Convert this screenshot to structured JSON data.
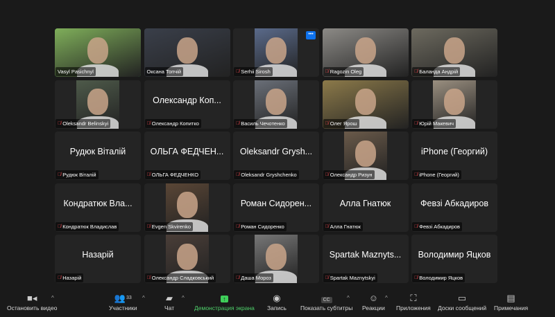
{
  "participants": [
    {
      "name": "Vasyl Pasichnyl",
      "video": "full",
      "color": "#7fae5a",
      "active": true,
      "muted": false
    },
    {
      "name": "Оксана Топчій",
      "video": "full",
      "color": "#3a3f4a",
      "muted": false
    },
    {
      "name": "Serhii Sirosh",
      "video": "center",
      "color": "#5a6a8a",
      "muted": true,
      "more": true
    },
    {
      "name": "Ragozin Oleg",
      "video": "full",
      "color": "#8c8a86",
      "muted": true
    },
    {
      "name": "Баланда Андрій",
      "video": "full",
      "color": "#6d6a5f",
      "muted": true
    },
    {
      "name": "Oleksandr Belinskyi",
      "video": "center",
      "color": "#4e5a4a",
      "muted": true
    },
    {
      "name": "Олександр Копитко",
      "display": "Олександр Коп...",
      "muted": true
    },
    {
      "name": "Василь Чечотенко",
      "video": "center",
      "color": "#6a6f78",
      "muted": true
    },
    {
      "name": "Олег Ярош",
      "video": "full",
      "color": "#8c7a4a",
      "muted": true
    },
    {
      "name": "Юрій Макевич",
      "video": "center",
      "color": "#9a8f80",
      "muted": true
    },
    {
      "name": "Рудюк Віталій",
      "display": "Рудюк Віталій",
      "muted": true
    },
    {
      "name": "ОЛЬГА ФЕДЧЕНКО",
      "display": "ОЛЬГА ФЕДЧЕН...",
      "muted": true
    },
    {
      "name": "Oleksandr Gryshchenko",
      "display": "Oleksandr Grysh...",
      "muted": true
    },
    {
      "name": "Олександр Ризун",
      "video": "center",
      "color": "#6a5a4a",
      "muted": true
    },
    {
      "name": "iPhone (Георгий)",
      "display": "iPhone (Георгий)",
      "muted": true
    },
    {
      "name": "Кондратюк Владислав",
      "display": "Кондратюк Вла...",
      "muted": true
    },
    {
      "name": "Evgen Skvirenko",
      "video": "center",
      "color": "#5a4636",
      "muted": true
    },
    {
      "name": "Роман Сидоренко",
      "display": "Роман Сидорен...",
      "muted": true
    },
    {
      "name": "Алла Гнатюк",
      "display": "Алла Гнатюк",
      "muted": true
    },
    {
      "name": "Февзі Абкадиров",
      "display": "Февзі Абкадиров",
      "muted": true
    },
    {
      "name": "Назарій",
      "display": "Назарій",
      "muted": true
    },
    {
      "name": "Олександр Сладковський",
      "video": "center",
      "color": "#4a3e38",
      "muted": true
    },
    {
      "name": "Даша Мороз",
      "video": "center",
      "color": "#777777",
      "muted": true
    },
    {
      "name": "Spartak Maznytskyi",
      "display": "Spartak Maznyts...",
      "muted": true
    },
    {
      "name": "Володимир Яцков",
      "display": "Володимир Яцков",
      "muted": true
    }
  ],
  "toolbar": {
    "stop_video": "Остановить видео",
    "participants": "Участники",
    "participants_count": "33",
    "chat": "Чат",
    "share_screen": "Демонстрация экрана",
    "record": "Запись",
    "captions": "Показать субтитры",
    "captions_icon_text": "CC",
    "reactions": "Реакции",
    "apps": "Приложения",
    "whiteboards": "Доски сообщений",
    "notes": "Примечания"
  },
  "colors": {
    "active_speaker": "#3fb950",
    "share": "#3fcf5a",
    "muted_mic": "#e5484d",
    "more_button": "#0e72ed"
  }
}
